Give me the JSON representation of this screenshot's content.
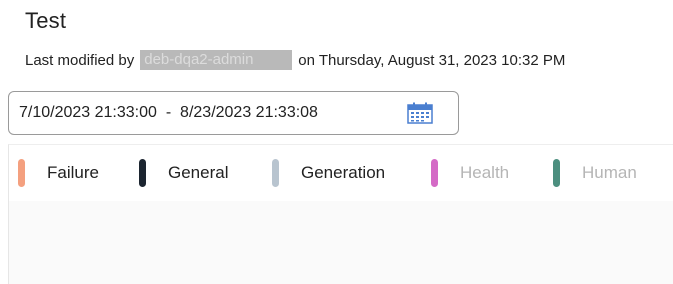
{
  "header": {
    "title": "Test",
    "modified_prefix": "Last modified by",
    "modified_user": "deb-dqa2-admin",
    "modified_suffix": "on Thursday, August 31, 2023 10:32 PM"
  },
  "date_range": {
    "start": "7/10/2023 21:33:00",
    "separator": "-",
    "end": "8/23/2023 21:33:08",
    "icon": "calendar-icon"
  },
  "legend": {
    "items": [
      {
        "label": "Failure",
        "color": "#f4a07f",
        "active": true
      },
      {
        "label": "General",
        "color": "#1c2530",
        "active": true
      },
      {
        "label": "Generation",
        "color": "#b8c4cf",
        "active": true
      },
      {
        "label": "Health",
        "color": "#d46ac6",
        "active": false
      },
      {
        "label": "Human",
        "color": "#4c8f7f",
        "active": false
      }
    ]
  }
}
